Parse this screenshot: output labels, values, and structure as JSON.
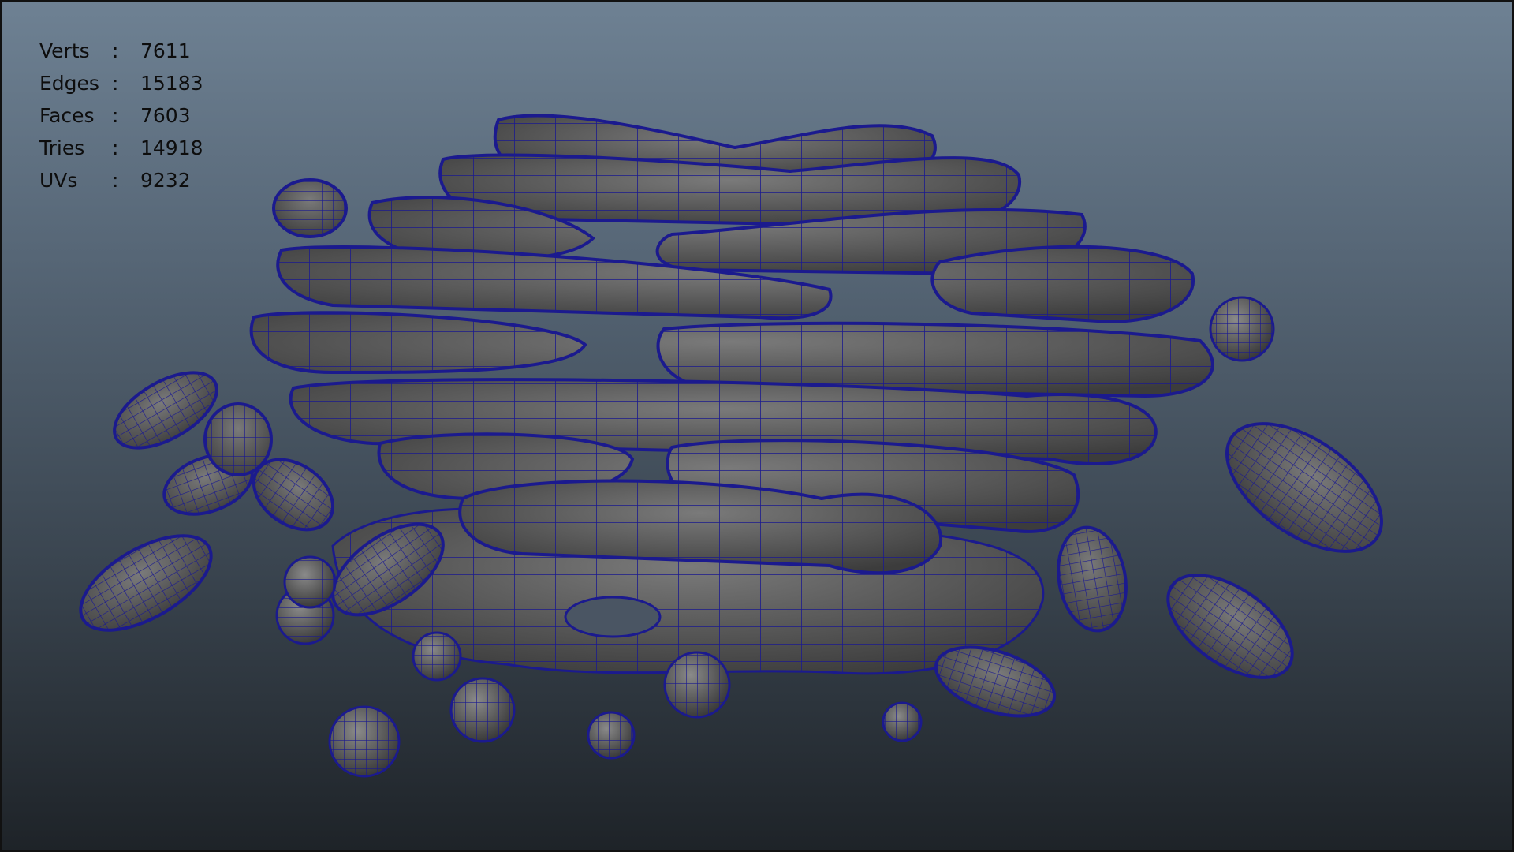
{
  "viewport": {
    "background_top": "#6e8193",
    "background_bottom": "#1e2328",
    "mesh_fill": "#5a5a5a",
    "wire_color": "#1b1a8e"
  },
  "hud": {
    "stats": [
      {
        "label": "Verts",
        "sep": ":",
        "value": "7611"
      },
      {
        "label": "Edges",
        "sep": ":",
        "value": "15183"
      },
      {
        "label": "Faces",
        "sep": ":",
        "value": "7603"
      },
      {
        "label": "Tries",
        "sep": ":",
        "value": "14918"
      },
      {
        "label": "UVs",
        "sep": ":",
        "value": "9232"
      }
    ]
  },
  "scene": {
    "object": "golgi-apparatus-mesh",
    "display_mode": "wireframe-on-shaded"
  }
}
